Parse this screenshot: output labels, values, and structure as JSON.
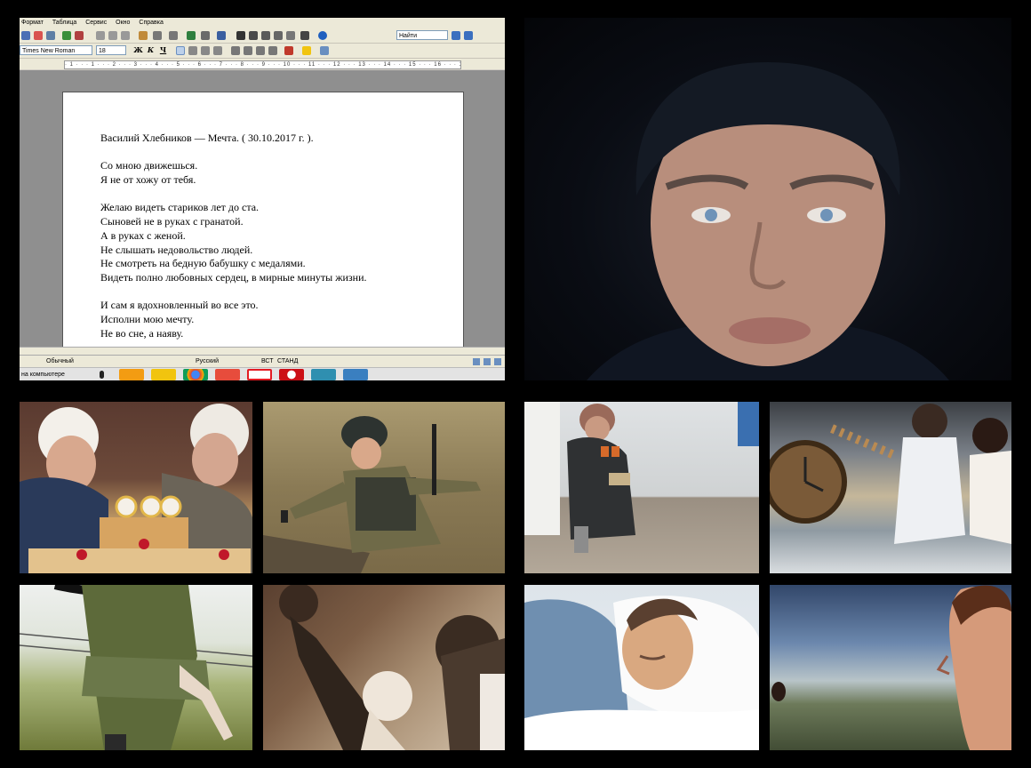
{
  "writer": {
    "menu": [
      "Формат",
      "Таблица",
      "Сервис",
      "Окно",
      "Справка"
    ],
    "font_name": "Times New Roman",
    "font_size": "18",
    "find_field": "Найти",
    "format_buttons": [
      "Ж",
      "К",
      "Ч"
    ],
    "ruler_marks": "· 1 · · · 1 · · · 2 · · · 3 · · · 4 · · · 5 · · · 6 · · · 7 · · · 8 · · · 9 · · · 10 · · · 11 · · · 12 · · · 13 · · · 14 · · · 15 · · · 16 · · · 17 · · · 18",
    "document": {
      "title_line": "Василий Хлебников — Мечта. ( 30.10.2017 г. ).",
      "stanzas": [
        [
          "Со мною движешься.",
          "Я не от хожу от тебя."
        ],
        [
          "Желаю видеть стариков лет до ста.",
          "Сыновей не в руках с гранатой.",
          "А в руках с женой.",
          "Не слышать недовольство людей.",
          "Не смотреть на бедную бабушку с медалями.",
          "Видеть полно любовных сердец, в мирные минуты жизни."
        ],
        [
          "И сам я вдохновленный во все это.",
          "Исполни мою мечту.",
          "Не во сне, а наяву."
        ]
      ]
    },
    "status": {
      "style": "Обычный",
      "language": "Русский",
      "mode_insert": "ВСТ",
      "mode_std": "СТАНД"
    },
    "taskbar": {
      "label": "на компьютере"
    }
  },
  "colors": {
    "background": "#000000",
    "toolbar": "#ece9d8",
    "doc_gray": "#8f8f8f"
  },
  "photos": [
    {
      "name": "portrait-man-in-beanie-photo"
    },
    {
      "name": "centenarian-women-cake-photo"
    },
    {
      "name": "soldier-with-grenade-photo"
    },
    {
      "name": "old-woman-with-medals-photo"
    },
    {
      "name": "couple-by-sea-clock-photo"
    },
    {
      "name": "soldier-embracing-woman-photo"
    },
    {
      "name": "protest-fists-photo"
    },
    {
      "name": "sleeping-man-photo"
    },
    {
      "name": "young-man-sky-photo"
    }
  ]
}
